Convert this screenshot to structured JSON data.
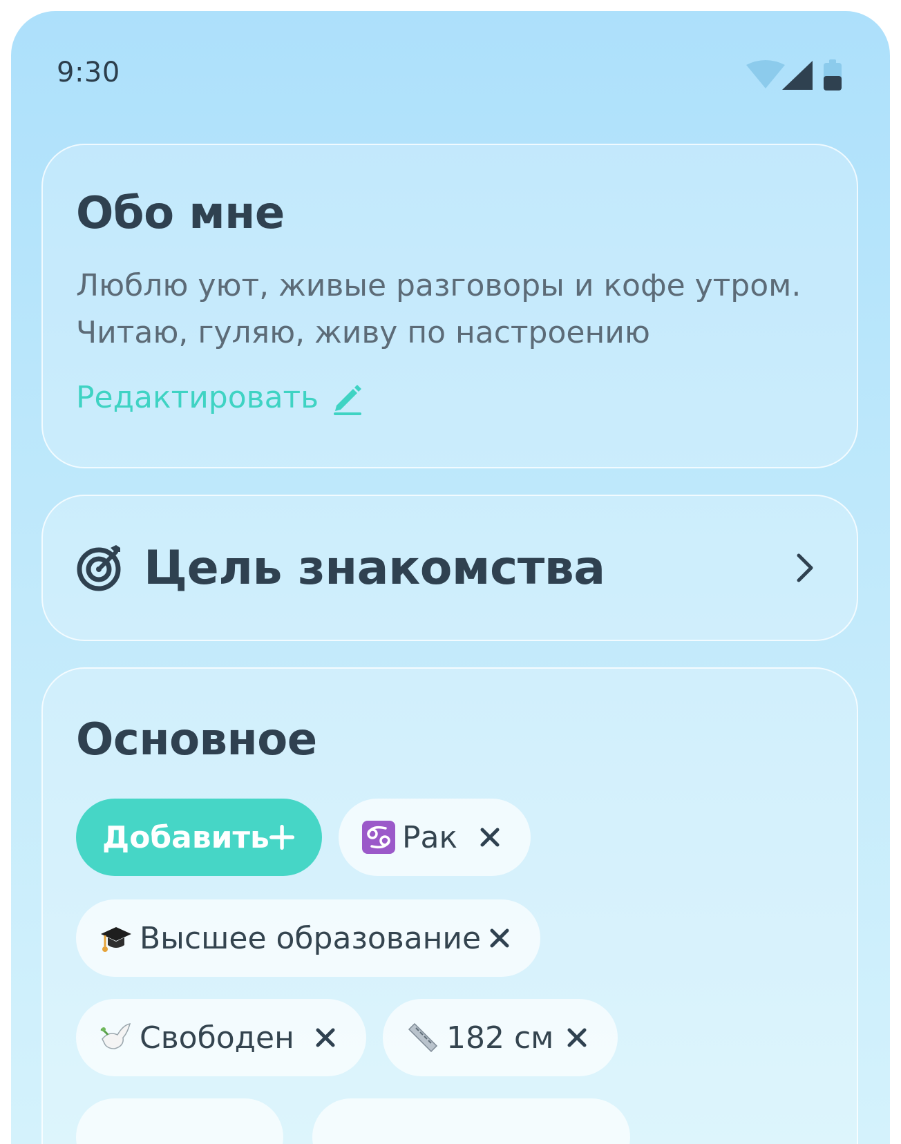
{
  "status_bar": {
    "time": "9:30",
    "icons": [
      "wifi-icon",
      "signal-icon",
      "battery-icon"
    ]
  },
  "about": {
    "title": "Обо мне",
    "text_line1": "Люблю уют, живые разговоры и кофе утром.",
    "text_line2": "Читаю, гуляю, живу по настроению",
    "edit_label": "Редактировать",
    "edit_icon": "pencil-icon"
  },
  "goal": {
    "title": "Цель знакомства",
    "icon": "target-icon",
    "chevron_icon": "chevron-right-icon"
  },
  "main": {
    "title": "Основное",
    "add_label": "Добавить",
    "chips": [
      {
        "label": "Рак",
        "icon": "cancer-zodiac-icon"
      },
      {
        "label": "Высшее образование",
        "icon": "graduation-cap-icon"
      },
      {
        "label": "Свободен",
        "icon": "dove-icon"
      },
      {
        "label": "182 см",
        "icon": "ruler-icon"
      }
    ]
  },
  "colors": {
    "accent": "#46d6c6",
    "text_dark": "#2f4150",
    "text_muted": "#5c6b77",
    "background_top": "#ade0fb"
  }
}
